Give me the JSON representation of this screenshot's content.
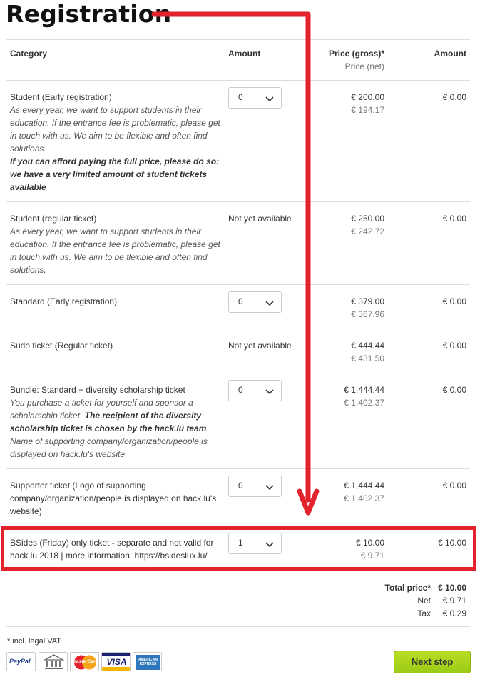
{
  "page": {
    "title": "Registration"
  },
  "table": {
    "headers": {
      "category": "Category",
      "amount_select": "Amount",
      "price_gross": "Price (gross)*",
      "price_net": "Price (net)",
      "amount_total": "Amount"
    },
    "rows": [
      {
        "name": "Student (Early registration)",
        "description_1": "As every year, we want to support students in their education. If the entrance fee is problematic, please get in touch with us. We aim to be flexible and often find solutions.",
        "description_bold": "If you can afford paying the full price, please do so: we have a very limited amount of student tickets available",
        "quantity": "0",
        "gross": "€ 200.00",
        "net": "€ 194.17",
        "total": "€ 0.00"
      },
      {
        "name": "Student (regular ticket)",
        "description_1": "As every year, we want to support students in their education. If the entrance fee is problematic, please get in touch with us. We aim to be flexible and often find solutions.",
        "availability": "Not yet available",
        "gross": "€ 250.00",
        "net": "€ 242.72",
        "total": "€ 0.00"
      },
      {
        "name": "Standard (Early registration)",
        "quantity": "0",
        "gross": "€ 379.00",
        "net": "€ 367.96",
        "total": "€ 0.00"
      },
      {
        "name": "Sudo ticket (Regular ticket)",
        "availability": "Not yet available",
        "gross": "€ 444.44",
        "net": "€ 431.50",
        "total": "€ 0.00"
      },
      {
        "name": "Bundle: Standard + diversity scholarship ticket",
        "description_1": "You purchase a ticket for yourself and sponsor a scholarschip ticket.",
        "description_bold": "The recipient of the diversity scholarship ticket is chosen by the hack.lu team",
        "description_2": ".",
        "description_3": "Name of supporting company/organization/people is displayed on hack.lu's website",
        "quantity": "0",
        "gross": "€ 1,444.44",
        "net": "€ 1,402.37",
        "total": "€ 0.00"
      },
      {
        "name": "Supporter ticket (Logo of supporting company/organization/people is displayed on hack.lu's website)",
        "quantity": "0",
        "gross": "€ 1,444.44",
        "net": "€ 1,402.37",
        "total": "€ 0.00"
      },
      {
        "name": "BSides (Friday) only ticket - separate and not valid for hack.lu 2018 | more information: https://bsideslux.lu/",
        "quantity": "1",
        "gross": "€ 10.00",
        "net": "€ 9.71",
        "total": "€ 10.00"
      }
    ]
  },
  "totals": {
    "total_label": "Total price*",
    "total_value": "€ 10.00",
    "net_label": "Net",
    "net_value": "€ 9.71",
    "tax_label": "Tax",
    "tax_value": "€ 0.29"
  },
  "footer": {
    "vat_note": "* incl. legal VAT",
    "next_label": "Next step"
  },
  "payment_icons": {
    "paypal": "PayPal",
    "mastercard": "MasterCard",
    "visa": "VISA",
    "amex": "AMERICAN EXPRESS"
  },
  "colors": {
    "annotation": "#e3232c",
    "button": "#a8d41c"
  }
}
